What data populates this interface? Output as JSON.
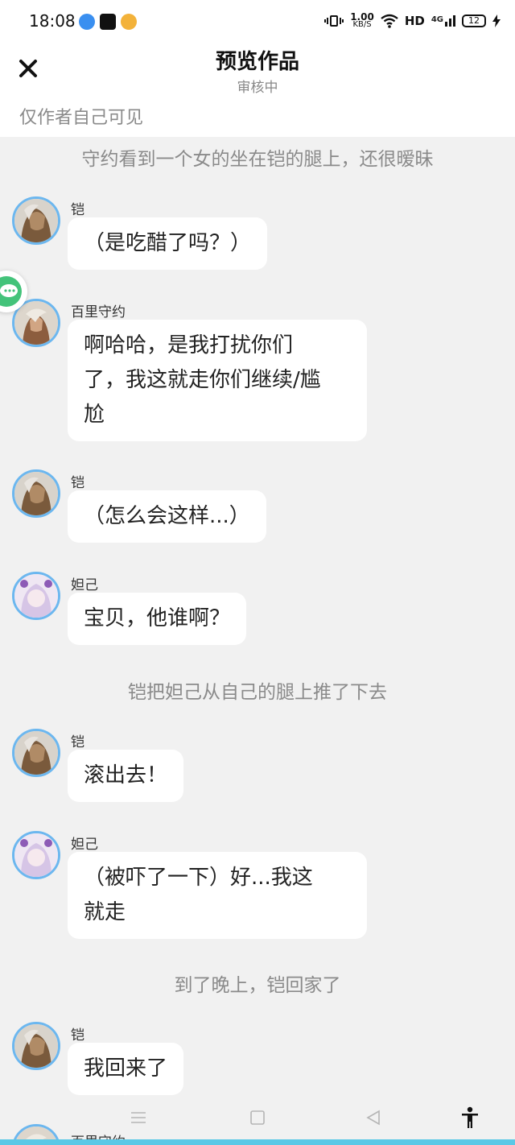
{
  "status_bar": {
    "time": "18:08",
    "net_speed_value": "1.00",
    "net_speed_unit": "KB/S",
    "hd_label": "HD",
    "network_label": "4G",
    "battery": "12"
  },
  "header": {
    "title": "预览作品",
    "subtitle": "审核中",
    "visibility_note": "仅作者自己可见"
  },
  "chat": {
    "items": [
      {
        "type": "narration",
        "text": "守约看到一个女的坐在铠的腿上，还很暧昧"
      },
      {
        "type": "message",
        "speaker": "铠",
        "avatar": "kai-avatar",
        "lines": [
          "（是吃醋了吗？）"
        ]
      },
      {
        "type": "message",
        "speaker": "百里守约",
        "avatar": "shouyue-avatar",
        "lines": [
          "啊哈哈，是我打扰你们",
          "了，我这就走你们继续/尴",
          "尬"
        ]
      },
      {
        "type": "message",
        "speaker": "铠",
        "avatar": "kai-avatar",
        "lines": [
          "（怎么会这样...）"
        ]
      },
      {
        "type": "message",
        "speaker": "妲己",
        "avatar": "daji-avatar",
        "lines": [
          "宝贝，他谁啊？"
        ]
      },
      {
        "type": "narration",
        "text": "铠把妲己从自己的腿上推了下去"
      },
      {
        "type": "message",
        "speaker": "铠",
        "avatar": "kai-avatar",
        "lines": [
          "滚出去！"
        ]
      },
      {
        "type": "message",
        "speaker": "妲己",
        "avatar": "daji-avatar",
        "lines": [
          "（被吓了一下）好...我这",
          "就走"
        ]
      },
      {
        "type": "narration",
        "text": "到了晚上，铠回家了"
      },
      {
        "type": "message",
        "speaker": "铠",
        "avatar": "kai-avatar",
        "lines": [
          "我回来了"
        ]
      },
      {
        "type": "message",
        "speaker": "百里守约",
        "avatar": "shouyue-avatar",
        "lines": []
      }
    ]
  },
  "nav": {
    "icons": [
      "menu-icon",
      "home-square-icon",
      "back-triangle-icon",
      "accessibility-icon"
    ]
  },
  "colors": {
    "background": "#f1f1f1",
    "bubble": "#ffffff",
    "avatar_ring": "#6cb7ef",
    "bottom_accent": "#5ac8e6"
  }
}
